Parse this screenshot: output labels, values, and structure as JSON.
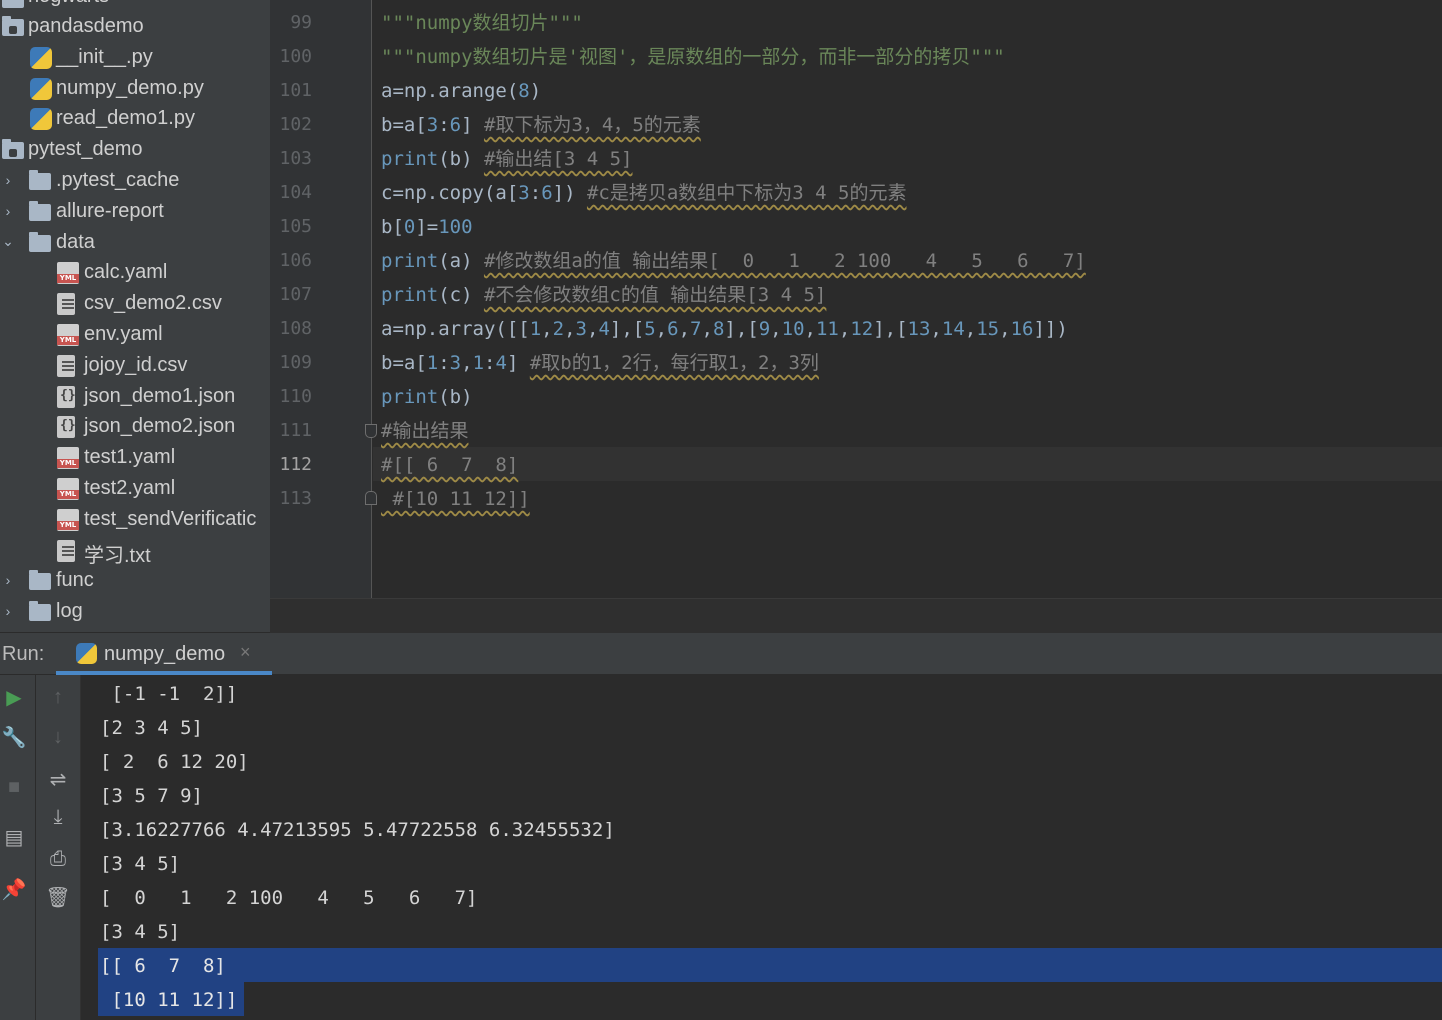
{
  "project_tree": {
    "partial_top": "hogwarts",
    "items": [
      {
        "label": "pandasdemo",
        "icon": "package-folder-icon",
        "chevron": ""
      },
      {
        "label": "__init__.py",
        "icon": "python-file-icon",
        "chevron": ""
      },
      {
        "label": "numpy_demo.py",
        "icon": "python-file-icon",
        "chevron": ""
      },
      {
        "label": "read_demo1.py",
        "icon": "python-file-icon",
        "chevron": ""
      },
      {
        "label": "pytest_demo",
        "icon": "package-folder-icon",
        "chevron": ""
      },
      {
        "label": ".pytest_cache",
        "icon": "folder-icon",
        "chevron": "›"
      },
      {
        "label": "allure-report",
        "icon": "folder-icon",
        "chevron": "›"
      },
      {
        "label": "data",
        "icon": "folder-icon",
        "chevron": "⌄"
      },
      {
        "label": "calc.yaml",
        "icon": "yaml-file-icon",
        "chevron": ""
      },
      {
        "label": "csv_demo2.csv",
        "icon": "text-file-icon",
        "chevron": ""
      },
      {
        "label": "env.yaml",
        "icon": "yaml-file-icon",
        "chevron": ""
      },
      {
        "label": "jojoy_id.csv",
        "icon": "text-file-icon",
        "chevron": ""
      },
      {
        "label": "json_demo1.json",
        "icon": "json-file-icon",
        "chevron": ""
      },
      {
        "label": "json_demo2.json",
        "icon": "json-file-icon",
        "chevron": ""
      },
      {
        "label": "test1.yaml",
        "icon": "yaml-file-icon",
        "chevron": ""
      },
      {
        "label": "test2.yaml",
        "icon": "yaml-file-icon",
        "chevron": ""
      },
      {
        "label": "test_sendVerificatic",
        "icon": "yaml-file-icon",
        "chevron": ""
      },
      {
        "label": "学习.txt",
        "icon": "text-file-icon",
        "chevron": ""
      },
      {
        "label": "func",
        "icon": "folder-icon",
        "chevron": "›"
      },
      {
        "label": "log",
        "icon": "folder-icon",
        "chevron": "›"
      }
    ]
  },
  "editor": {
    "current_line": "112",
    "lines": [
      {
        "num": "99",
        "tokens": [
          {
            "t": "\"\"\"numpy数组切片\"\"\"",
            "c": "str"
          }
        ]
      },
      {
        "num": "100",
        "tokens": [
          {
            "t": "\"\"\"numpy数组切片是'视图'，是原数组的一部分，而非一部分的拷贝\"\"\"",
            "c": "str"
          }
        ]
      },
      {
        "num": "101",
        "tokens": [
          {
            "t": "a=np.arange(",
            "c": ""
          },
          {
            "t": "8",
            "c": "num"
          },
          {
            "t": ")",
            "c": ""
          }
        ]
      },
      {
        "num": "102",
        "tokens": [
          {
            "t": "b=a[",
            "c": ""
          },
          {
            "t": "3",
            "c": "num"
          },
          {
            "t": ":",
            "c": ""
          },
          {
            "t": "6",
            "c": "num"
          },
          {
            "t": "] ",
            "c": ""
          },
          {
            "t": "#取下标为3，4，5的元素",
            "c": "cmt"
          }
        ]
      },
      {
        "num": "103",
        "tokens": [
          {
            "t": "print",
            "c": "num"
          },
          {
            "t": "(b) ",
            "c": ""
          },
          {
            "t": "#输出结[3 4 5]",
            "c": "cmt"
          }
        ]
      },
      {
        "num": "104",
        "tokens": [
          {
            "t": "c=np.copy(a[",
            "c": ""
          },
          {
            "t": "3",
            "c": "num"
          },
          {
            "t": ":",
            "c": ""
          },
          {
            "t": "6",
            "c": "num"
          },
          {
            "t": "]) ",
            "c": ""
          },
          {
            "t": "#c是拷贝a数组中下标为3 4 5的元素",
            "c": "cmt"
          }
        ]
      },
      {
        "num": "105",
        "tokens": [
          {
            "t": "b[",
            "c": ""
          },
          {
            "t": "0",
            "c": "num"
          },
          {
            "t": "]=",
            "c": ""
          },
          {
            "t": "100",
            "c": "num"
          }
        ]
      },
      {
        "num": "106",
        "tokens": [
          {
            "t": "print",
            "c": "num"
          },
          {
            "t": "(a) ",
            "c": ""
          },
          {
            "t": "#修改数组a的值 输出结果[  0   1   2 100   4   5   6   7]",
            "c": "cmt"
          }
        ]
      },
      {
        "num": "107",
        "tokens": [
          {
            "t": "print",
            "c": "num"
          },
          {
            "t": "(c) ",
            "c": ""
          },
          {
            "t": "#不会修改数组c的值 输出结果[3 4 5]",
            "c": "cmt"
          }
        ]
      },
      {
        "num": "108",
        "tokens": [
          {
            "t": "a=np.array([[",
            "c": ""
          },
          {
            "t": "1",
            "c": "num"
          },
          {
            "t": ",",
            "c": ""
          },
          {
            "t": "2",
            "c": "num"
          },
          {
            "t": ",",
            "c": ""
          },
          {
            "t": "3",
            "c": "num"
          },
          {
            "t": ",",
            "c": ""
          },
          {
            "t": "4",
            "c": "num"
          },
          {
            "t": "],[",
            "c": ""
          },
          {
            "t": "5",
            "c": "num"
          },
          {
            "t": ",",
            "c": ""
          },
          {
            "t": "6",
            "c": "num"
          },
          {
            "t": ",",
            "c": ""
          },
          {
            "t": "7",
            "c": "num"
          },
          {
            "t": ",",
            "c": ""
          },
          {
            "t": "8",
            "c": "num"
          },
          {
            "t": "],[",
            "c": ""
          },
          {
            "t": "9",
            "c": "num"
          },
          {
            "t": ",",
            "c": ""
          },
          {
            "t": "10",
            "c": "num"
          },
          {
            "t": ",",
            "c": ""
          },
          {
            "t": "11",
            "c": "num"
          },
          {
            "t": ",",
            "c": ""
          },
          {
            "t": "12",
            "c": "num"
          },
          {
            "t": "],[",
            "c": ""
          },
          {
            "t": "13",
            "c": "num"
          },
          {
            "t": ",",
            "c": ""
          },
          {
            "t": "14",
            "c": "num"
          },
          {
            "t": ",",
            "c": ""
          },
          {
            "t": "15",
            "c": "num"
          },
          {
            "t": ",",
            "c": ""
          },
          {
            "t": "16",
            "c": "num"
          },
          {
            "t": "]])",
            "c": ""
          }
        ]
      },
      {
        "num": "109",
        "tokens": [
          {
            "t": "b=a[",
            "c": ""
          },
          {
            "t": "1",
            "c": "num"
          },
          {
            "t": ":",
            "c": ""
          },
          {
            "t": "3",
            "c": "num"
          },
          {
            "t": ",",
            "c": ""
          },
          {
            "t": "1",
            "c": "num"
          },
          {
            "t": ":",
            "c": ""
          },
          {
            "t": "4",
            "c": "num"
          },
          {
            "t": "] ",
            "c": ""
          },
          {
            "t": "#取b的1，2行，每行取1，2，3列",
            "c": "cmt"
          }
        ]
      },
      {
        "num": "110",
        "tokens": [
          {
            "t": "print",
            "c": "num"
          },
          {
            "t": "(b)",
            "c": ""
          }
        ]
      },
      {
        "num": "111",
        "tokens": [
          {
            "t": "#输出结果",
            "c": "cmt"
          }
        ]
      },
      {
        "num": "112",
        "tokens": [
          {
            "t": "#[[ 6  7  8]",
            "c": "cmt"
          }
        ]
      },
      {
        "num": "113",
        "tokens": [
          {
            "t": " #[10 11 12]]",
            "c": "cmt"
          }
        ]
      }
    ]
  },
  "run_panel": {
    "label": "Run:",
    "tab_label": "numpy_demo",
    "tab_close": "×",
    "output": [
      " [-1 -1  2]]",
      "[2 3 4 5]",
      "[ 2  6 12 20]",
      "[3 5 7 9]",
      "[3.16227766 4.47213595 5.47722558 6.32455532]",
      "[3 4 5]",
      "[  0   1   2 100   4   5   6   7]",
      "[3 4 5]",
      "[[ 6  7  8]",
      " [10 11 12]]"
    ],
    "toolbar_left": [
      {
        "name": "rerun-icon",
        "glyph": "▶"
      },
      {
        "name": "wrench-icon",
        "glyph": "🔧"
      },
      {
        "name": "stop-icon",
        "glyph": "■"
      },
      {
        "name": "layout-icon",
        "glyph": "▤"
      },
      {
        "name": "pin-icon",
        "glyph": "📌"
      }
    ],
    "toolbar_right": [
      {
        "name": "scroll-up-icon",
        "glyph": "↑"
      },
      {
        "name": "scroll-down-icon",
        "glyph": "↓"
      },
      {
        "name": "soft-wrap-icon",
        "glyph": "⇌"
      },
      {
        "name": "scroll-to-end-icon",
        "glyph": "⤓"
      },
      {
        "name": "print-icon",
        "glyph": "⎙"
      },
      {
        "name": "trash-icon",
        "glyph": "🗑"
      }
    ]
  },
  "colors": {
    "selection": "#214283",
    "keyword_blue": "#6897bb",
    "string_green": "#6a8759",
    "comment_gray": "#808080",
    "run_green": "#499c54"
  }
}
